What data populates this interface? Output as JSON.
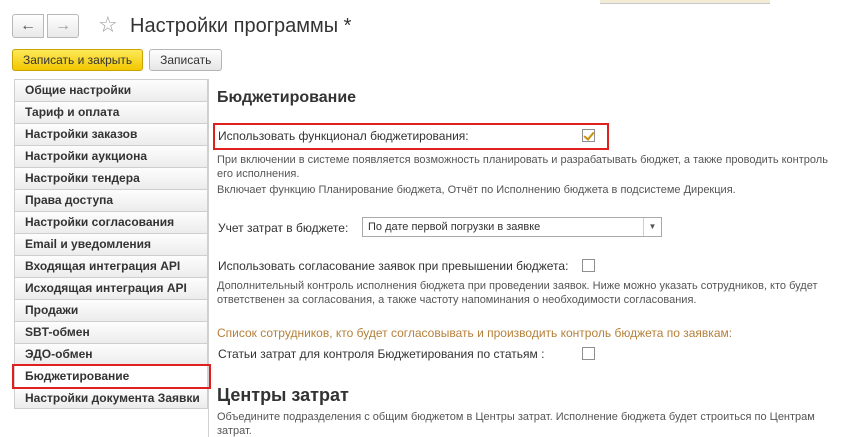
{
  "window": {
    "title": "Настройки программы *"
  },
  "toolbar": {
    "save_close_label": "Записать и закрыть",
    "save_label": "Записать"
  },
  "sidebar": {
    "items": [
      {
        "label": "Общие настройки"
      },
      {
        "label": "Тариф и оплата"
      },
      {
        "label": "Настройки заказов"
      },
      {
        "label": "Настройки аукциона"
      },
      {
        "label": "Настройки тендера"
      },
      {
        "label": "Права доступа"
      },
      {
        "label": "Настройки согласования"
      },
      {
        "label": "Email и уведомления"
      },
      {
        "label": "Входящая интеграция API"
      },
      {
        "label": "Исходящая интеграция API"
      },
      {
        "label": "Продажи"
      },
      {
        "label": "SBT-обмен"
      },
      {
        "label": "ЭДО-обмен"
      },
      {
        "label": "Бюджетирование"
      },
      {
        "label": "Настройки документа Заявки"
      }
    ],
    "selected": "Бюджетирование"
  },
  "main": {
    "section_title": "Бюджетирование",
    "use_budgeting": {
      "label": "Использовать функционал бюджетирования:",
      "checked": true
    },
    "hint_1": "При включении в системе появляется возможность планировать и разрабатывать бюджет, а также проводить контроль его исполнения.",
    "hint_2": "Включает функцию Планирование бюджета, Отчёт по Исполнению бюджета в подсистеме Дирекция.",
    "cost_accounting": {
      "label": "Учет затрат в бюджете:",
      "value": "По дате первой погрузки в заявке"
    },
    "approval_over_budget": {
      "label": "Использовать согласование заявок при превышении бюджета:",
      "checked": false
    },
    "hint_3": "Дополнительный контроль исполнения бюджета при проведении заявок. Ниже можно указать сотрудников, кто будет ответственен за согласования, а также частоту напоминания о необходимости согласования.",
    "employees_link": "Список сотрудников, кто будет согласовывать и производить контроль бюджета по заявкам:",
    "articles_control": {
      "label": "Статьи затрат для контроля Бюджетирования по статьям :",
      "checked": false
    },
    "cost_centers_title": "Центры затрат",
    "hint_4": "Объедините подразделения с общим бюджетом в Центры затрат. Исполнение бюджета будет строиться по Центрам затрат."
  },
  "colors": {
    "highlight_outline": "#e0201e",
    "primary_button": "#f2c700",
    "link_text": "#b5803a",
    "checkmark": "#c7900a"
  }
}
